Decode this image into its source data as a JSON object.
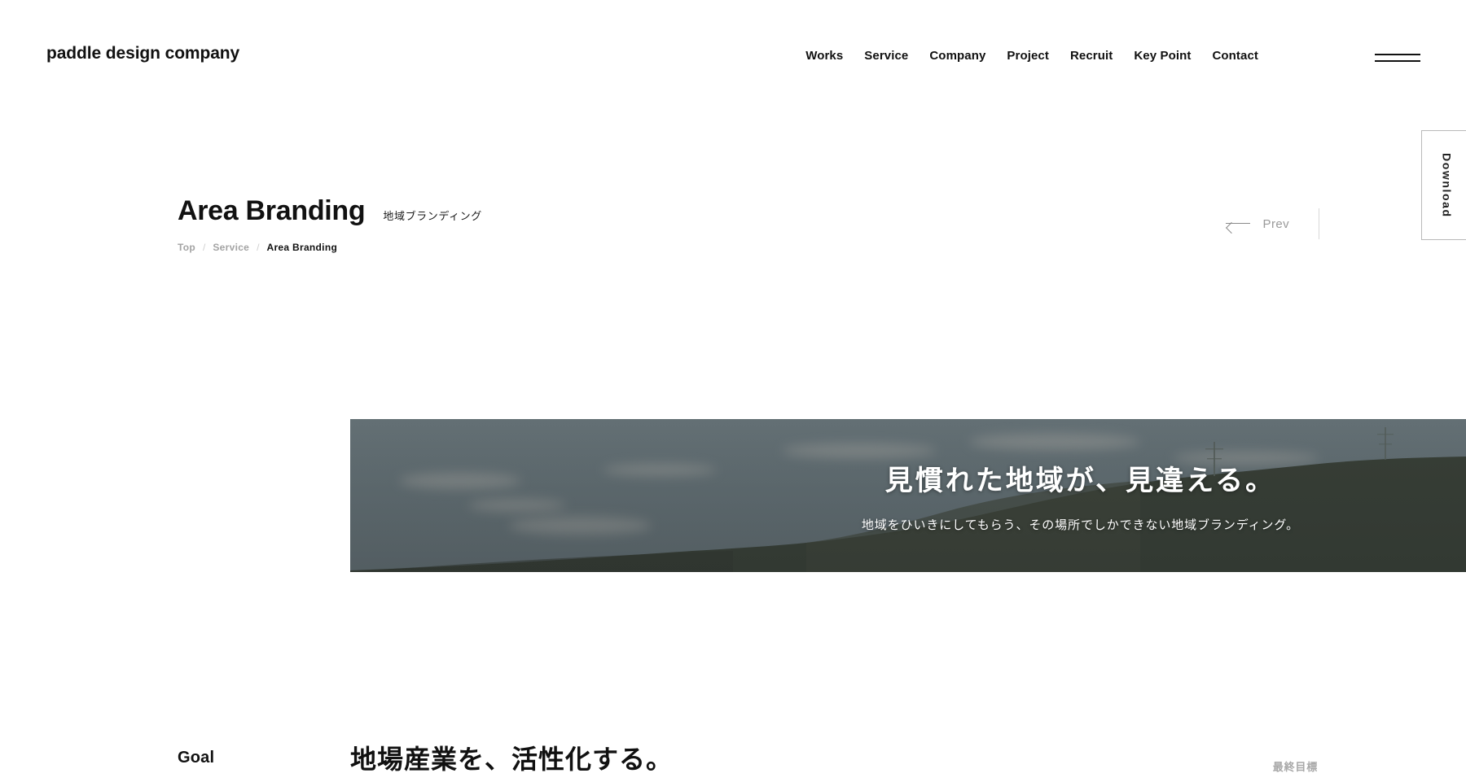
{
  "header": {
    "logo": "paddle design company",
    "nav": [
      {
        "label": "Works"
      },
      {
        "label": "Service"
      },
      {
        "label": "Company"
      },
      {
        "label": "Project"
      },
      {
        "label": "Recruit"
      },
      {
        "label": "Key Point"
      },
      {
        "label": "Contact"
      }
    ],
    "menu_icon": "hamburger-icon"
  },
  "side_tab": {
    "label": "Download"
  },
  "title": {
    "heading": "Area Branding",
    "subheading": "地域ブランディング",
    "breadcrumb": [
      {
        "label": "Top",
        "current": false
      },
      {
        "label": "Service",
        "current": false
      },
      {
        "label": "Area Branding",
        "current": true
      }
    ],
    "breadcrumb_separator": "/"
  },
  "pager": {
    "prev_label": "Prev",
    "prev_icon": "arrow-left-icon"
  },
  "hero": {
    "headline": "見慣れた地域が、見違える。",
    "subline": "地域をひいきにしてもらう、その場所でしかできない地域ブランディング。",
    "image_alt": "mountain-landscape-photo",
    "sky_color": "#6e7b80",
    "mountain_color": "#3b4138"
  },
  "goal": {
    "label": "Goal",
    "headline": "地場産業を、活性化する。",
    "note": "最終目標"
  },
  "colors": {
    "text": "#111111",
    "muted": "#a3a3a3",
    "background": "#ffffff",
    "border": "#b9b9b9"
  }
}
